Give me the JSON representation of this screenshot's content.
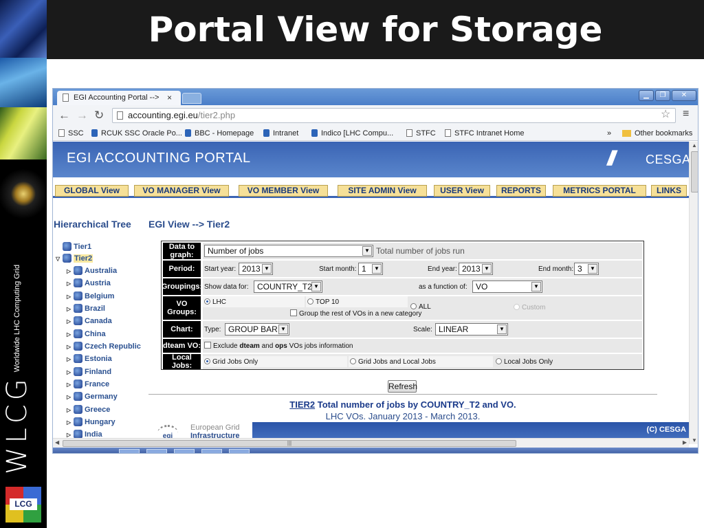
{
  "slide": {
    "title": "Portal View for Storage",
    "wlcg_logo_text": "WLCG",
    "wlcg_subtitle": "Worldwide LHC Computing Grid",
    "lcg_logo_text": "LCG"
  },
  "browser": {
    "tab_title": "EGI Accounting Portal -->",
    "tab_close": "×",
    "url_host": "accounting.egi.eu",
    "url_path": "/tier2.php",
    "bookmarks": [
      "SSC",
      "RCUK SSC Oracle Po...",
      "BBC - Homepage",
      "Intranet",
      "Indico [LHC Compu...",
      "STFC",
      "STFC Intranet Home"
    ],
    "bookmarks_more": "»",
    "other_bookmarks": "Other bookmarks"
  },
  "portal": {
    "header_title": "EGI ACCOUNTING PORTAL",
    "logo_text": "CESGA",
    "nav_tabs": [
      "GLOBAL View",
      "VO MANAGER View",
      "VO MEMBER View",
      "SITE ADMIN View",
      "USER View",
      "REPORTS",
      "METRICS PORTAL",
      "LINKS"
    ],
    "hierarchical_tree_title": "Hierarchical Tree",
    "breadcrumb": "EGI View --> Tier2",
    "tree": {
      "root": "Tier1",
      "selected": "Tier2",
      "children": [
        "Australia",
        "Austria",
        "Belgium",
        "Brazil",
        "Canada",
        "China",
        "Czech Republic",
        "Estonia",
        "Finland",
        "France",
        "Germany",
        "Greece",
        "Hungary",
        "India"
      ]
    },
    "form": {
      "data_to_graph": {
        "label": "Data to graph:",
        "value": "Number of jobs",
        "description": "Total number of jobs run"
      },
      "period": {
        "label": "Period:",
        "start_year_label": "Start year:",
        "start_year": "2013",
        "start_month_label": "Start month:",
        "start_month": "1",
        "end_year_label": "End year:",
        "end_year": "2013",
        "end_month_label": "End month:",
        "end_month": "3"
      },
      "groupings": {
        "label": "Groupings:",
        "show_data_label": "Show data for:",
        "show_data_value": "COUNTRY_T2",
        "function_label": "as a function of:",
        "function_value": "VO"
      },
      "vo_groups": {
        "label": "VO Groups:",
        "options": [
          "LHC",
          "TOP 10",
          "ALL",
          "Custom"
        ],
        "selected": "LHC",
        "group_rest_label": "Group the rest of VOs in a new category"
      },
      "chart": {
        "label": "Chart:",
        "type_label": "Type:",
        "type_value": "GROUP BAR",
        "scale_label": "Scale:",
        "scale_value": "LINEAR"
      },
      "dteam_vo": {
        "label": "dteam VO:",
        "text_exclude": "Exclude",
        "text_dteam": "dteam",
        "text_and": "and",
        "text_ops": "ops",
        "text_rest": "VOs jobs information"
      },
      "local_jobs": {
        "label": "Local Jobs:",
        "options": [
          "Grid Jobs Only",
          "Grid Jobs and Local Jobs",
          "Local Jobs Only"
        ],
        "selected": "Grid Jobs Only"
      }
    },
    "refresh_label": "Refresh",
    "result_link": "TIER2",
    "result_title": "Total number of jobs by COUNTRY_T2 and VO.",
    "result_subtitle": "LHC VOs. January 2013 - March 2013.",
    "egi_logo_line1": "European Grid",
    "egi_logo_line2": "Infrastructure",
    "egi_logo_mark": "egi",
    "footer_copyright": "(C) CESGA"
  },
  "colors": {
    "portal_blue": "#3a64b4",
    "tab_yellow": "#f6e098",
    "tree_text": "#2a5090"
  }
}
